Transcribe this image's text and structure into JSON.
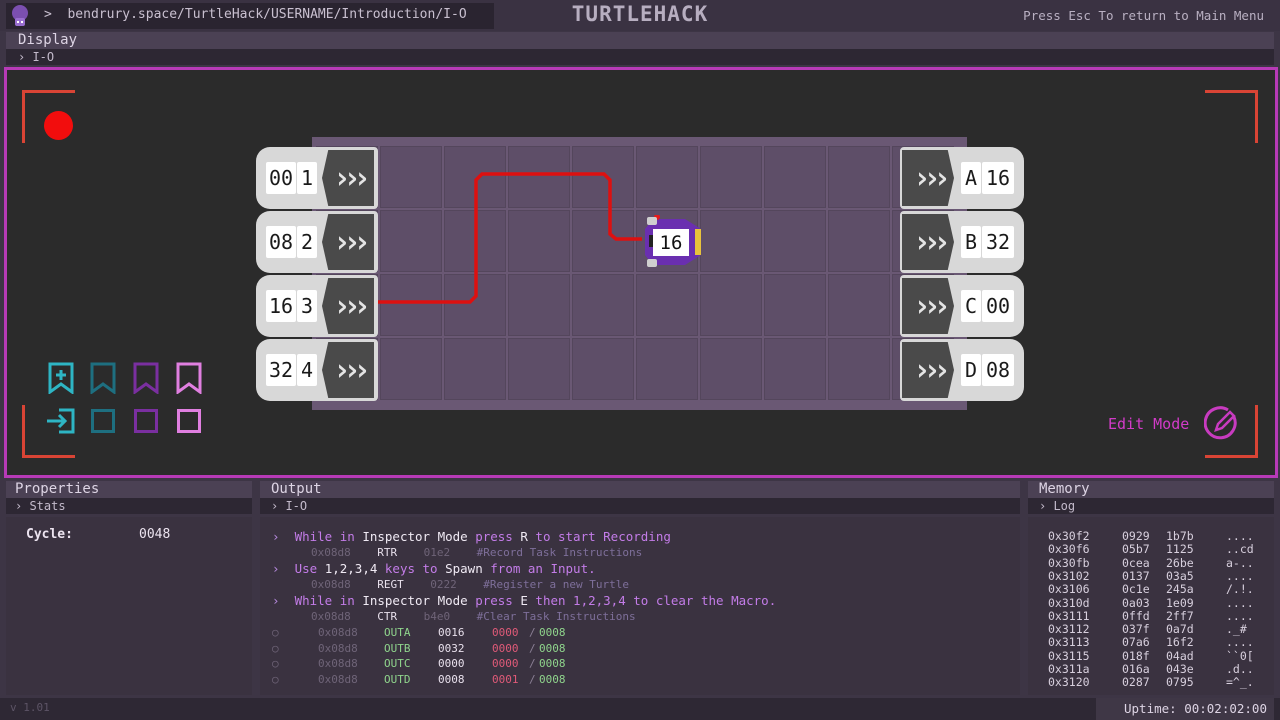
{
  "topbar": {
    "url": ">  bendrury.space/TurtleHack/USERNAME/Introduction/I-O",
    "title": "TURTLEHACK",
    "esc_hint": "Press Esc To return to Main Menu"
  },
  "display": {
    "title": "Display",
    "sub": "›  I-O",
    "inputs": [
      {
        "addr": "00",
        "num": "1"
      },
      {
        "addr": "08",
        "num": "2"
      },
      {
        "addr": "16",
        "num": "3"
      },
      {
        "addr": "32",
        "num": "4"
      }
    ],
    "outputs": [
      {
        "name": "A",
        "value": "16"
      },
      {
        "name": "B",
        "value": "32"
      },
      {
        "name": "C",
        "value": "00"
      },
      {
        "name": "D",
        "value": "08"
      }
    ],
    "turtle_value": "16",
    "edit_mode_label": "Edit Mode",
    "accent": "#b73ab7",
    "record_color": "#f20d0d"
  },
  "properties": {
    "title": "Properties",
    "sub": "›  Stats",
    "cycle_label": "Cycle:",
    "cycle_value": "0048"
  },
  "output": {
    "title": "Output",
    "sub": "›  I-O",
    "lines": [
      {
        "a": "While in ",
        "b": "Inspector Mode",
        "c": " press ",
        "d": "R",
        "e": " to start Recording"
      },
      {
        "addr": "0x08d8",
        "op": "RTR",
        "code": "01e2",
        "comment": "#Record Task Instructions"
      },
      {
        "a": "Use ",
        "b": "1,2,3,4",
        "c": " keys to ",
        "d": "Spawn",
        "e": " from an Input."
      },
      {
        "addr": "0x08d8",
        "op": "REGT",
        "code": "0222",
        "comment": "#Register a new Turtle"
      },
      {
        "a": "While in ",
        "b": "Inspector Mode",
        "c": " press ",
        "d": "E",
        "e": " then 1,2,3,4 to clear the Macro."
      },
      {
        "addr": "0x08d8",
        "op": "CTR",
        "code": "b4e0",
        "comment": "#Clear Task Instructions"
      }
    ],
    "table": [
      {
        "addr": "0x08d8",
        "op": "OUTA",
        "val": "0016",
        "cur": "0000",
        "sep": "/",
        "max": "0008"
      },
      {
        "addr": "0x08d8",
        "op": "OUTB",
        "val": "0032",
        "cur": "0000",
        "sep": "/",
        "max": "0008"
      },
      {
        "addr": "0x08d8",
        "op": "OUTC",
        "val": "0000",
        "cur": "0000",
        "sep": "/",
        "max": "0008"
      },
      {
        "addr": "0x08d8",
        "op": "OUTD",
        "val": "0008",
        "cur": "0001",
        "sep": "/",
        "max": "0008"
      }
    ]
  },
  "memory": {
    "title": "Memory",
    "sub": "›  Log",
    "rows": [
      [
        "0x30f2",
        "0929",
        "1b7b",
        "...."
      ],
      [
        "0x30f6",
        "05b7",
        "1125",
        "..cd"
      ],
      [
        "0x30fb",
        "0cea",
        "26be",
        "a-.."
      ],
      [
        "0x3102",
        "0137",
        "03a5",
        "...."
      ],
      [
        "0x3106",
        "0c1e",
        "245a",
        "/.!."
      ],
      [
        "0x310d",
        "0a03",
        "1e09",
        "...."
      ],
      [
        "0x3111",
        "0ffd",
        "2ff7",
        "...."
      ],
      [
        "0x3112",
        "037f",
        "0a7d",
        "._#"
      ],
      [
        "0x3113",
        "07a6",
        "16f2",
        "...."
      ],
      [
        "0x3115",
        "018f",
        "04ad",
        "``0["
      ],
      [
        "0x311a",
        "016a",
        "043e",
        ".d.."
      ],
      [
        "0x3120",
        "0287",
        "0795",
        "=^_."
      ]
    ]
  },
  "footer": {
    "version": "v 1.01",
    "uptime": "Uptime: 00:02:02:00"
  }
}
